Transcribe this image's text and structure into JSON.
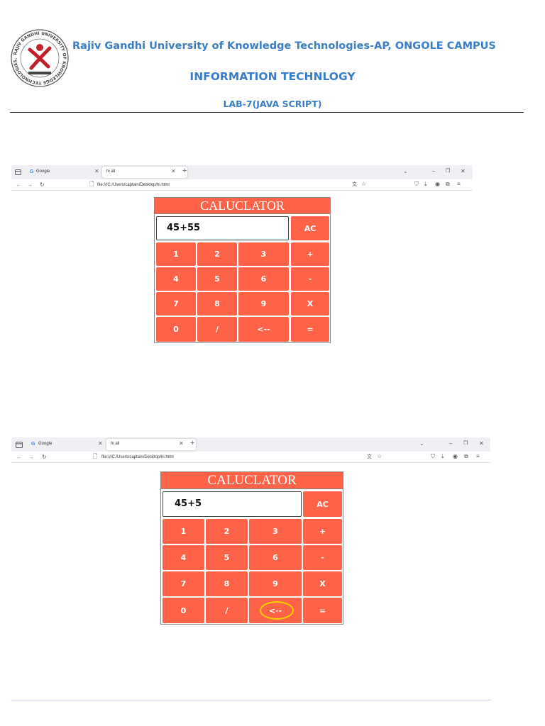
{
  "header": {
    "university": "Rajiv Gandhi University of Knowledge Technologies-AP, ONGOLE CAMPUS",
    "department": "INFORMATION TECHNLOGY",
    "lab": "LAB-7(JAVA SCRIPT)",
    "logo_text": "RAJIV GANDHI UNIVERSITY OF KNOWLEDGE TECHNOLOGIES, A.P. ONGOLE CAMPUS"
  },
  "screenshots": [
    {
      "browser": {
        "tab1_label": "Google",
        "tab2_label": "hi all",
        "url": "file:///C:/Users/captain/Desktop/hi.html"
      },
      "calculator": {
        "title": "CALUCLATOR",
        "display": "45+55",
        "keys": {
          "ac": "AC",
          "k1": "1",
          "k2": "2",
          "k3": "3",
          "plus": "+",
          "k4": "4",
          "k5": "5",
          "k6": "6",
          "minus": "-",
          "k7": "7",
          "k8": "8",
          "k9": "9",
          "times": "X",
          "k0": "0",
          "divide": "/",
          "back": "<--",
          "equals": "="
        }
      }
    },
    {
      "browser": {
        "tab1_label": "Google",
        "tab2_label": "hi all",
        "url": "file:///C:/Users/captain/Desktop/hi.html"
      },
      "calculator": {
        "title": "CALUCLATOR",
        "display": "45+5",
        "keys": {
          "ac": "AC",
          "k1": "1",
          "k2": "2",
          "k3": "3",
          "plus": "+",
          "k4": "4",
          "k5": "5",
          "k6": "6",
          "minus": "-",
          "k7": "7",
          "k8": "8",
          "k9": "9",
          "times": "X",
          "k0": "0",
          "divide": "/",
          "back": "<--",
          "equals": "="
        },
        "highlighted_key": "back"
      }
    }
  ],
  "colors": {
    "accent": "#ff6347",
    "heading_blue": "#3a7dc9",
    "highlight": "#f4d000",
    "logo_red": "#c0202a"
  },
  "icons": [
    "tab-overview-icon",
    "google-icon",
    "close-tab-icon",
    "new-tab-icon",
    "back-arrow-icon",
    "forward-arrow-icon",
    "reload-icon",
    "page-icon",
    "translate-icon",
    "bookmark-star-icon",
    "chevron-down-icon",
    "minimize-icon",
    "restore-icon",
    "close-window-icon",
    "pocket-icon",
    "download-icon",
    "account-icon",
    "extensions-icon",
    "menu-icon"
  ]
}
